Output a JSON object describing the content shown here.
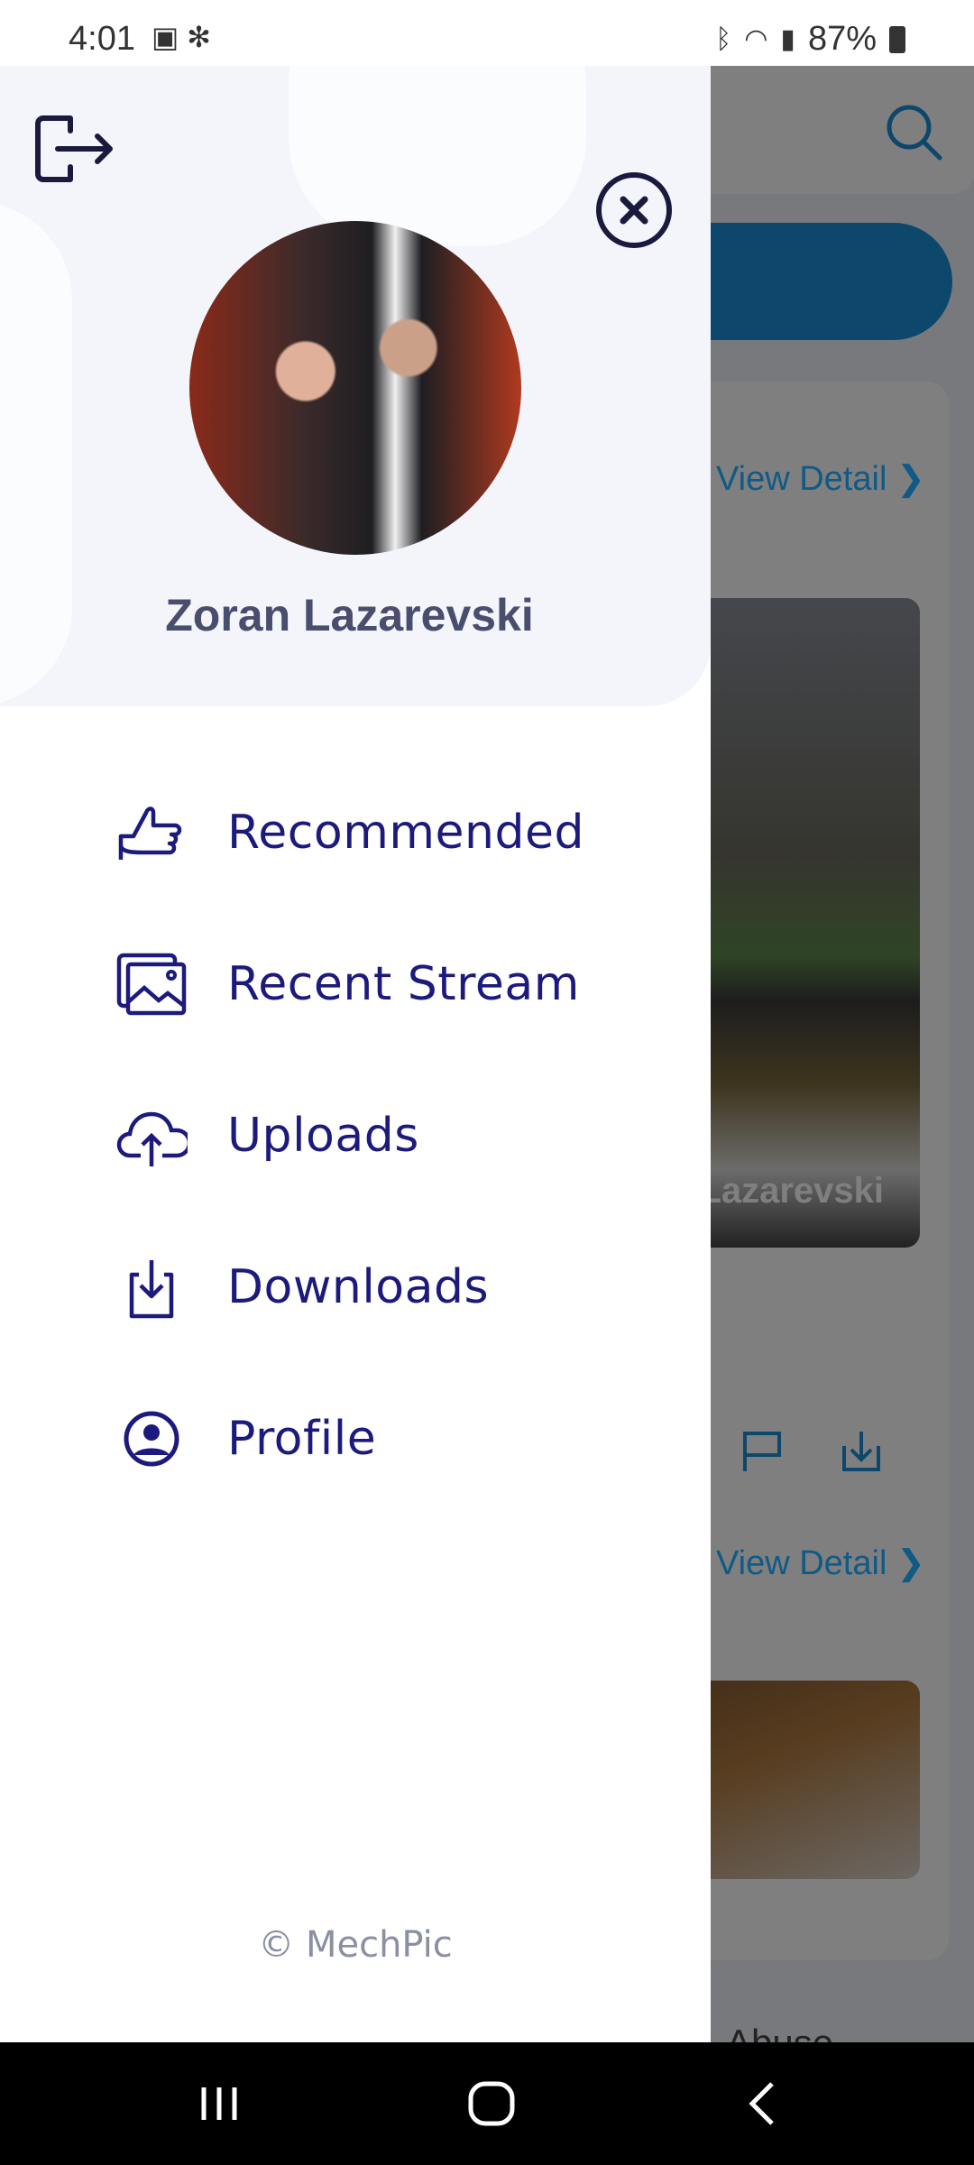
{
  "status_bar": {
    "time": "4:01",
    "battery": "87%",
    "icons": [
      "image-icon",
      "network-icon",
      "bluetooth-icon",
      "wifi-icon",
      "signal-icon",
      "battery-charging-icon"
    ]
  },
  "background": {
    "link_1": "View Detail",
    "link_2": "View Detail",
    "image_watermark": "Lazarevski",
    "footer_text": "Abuse",
    "accent": "#1a8fd6"
  },
  "drawer": {
    "user_name": "Zoran Lazarevski",
    "menu": [
      {
        "label": "Recommended",
        "icon": "thumbs-up-icon"
      },
      {
        "label": "Recent Stream",
        "icon": "images-icon"
      },
      {
        "label": "Uploads",
        "icon": "cloud-upload-icon"
      },
      {
        "label": "Downloads",
        "icon": "download-icon"
      },
      {
        "label": "Profile",
        "icon": "user-circle-icon"
      }
    ],
    "copyright": "© MechPic",
    "text_color": "#1c1a7c"
  }
}
